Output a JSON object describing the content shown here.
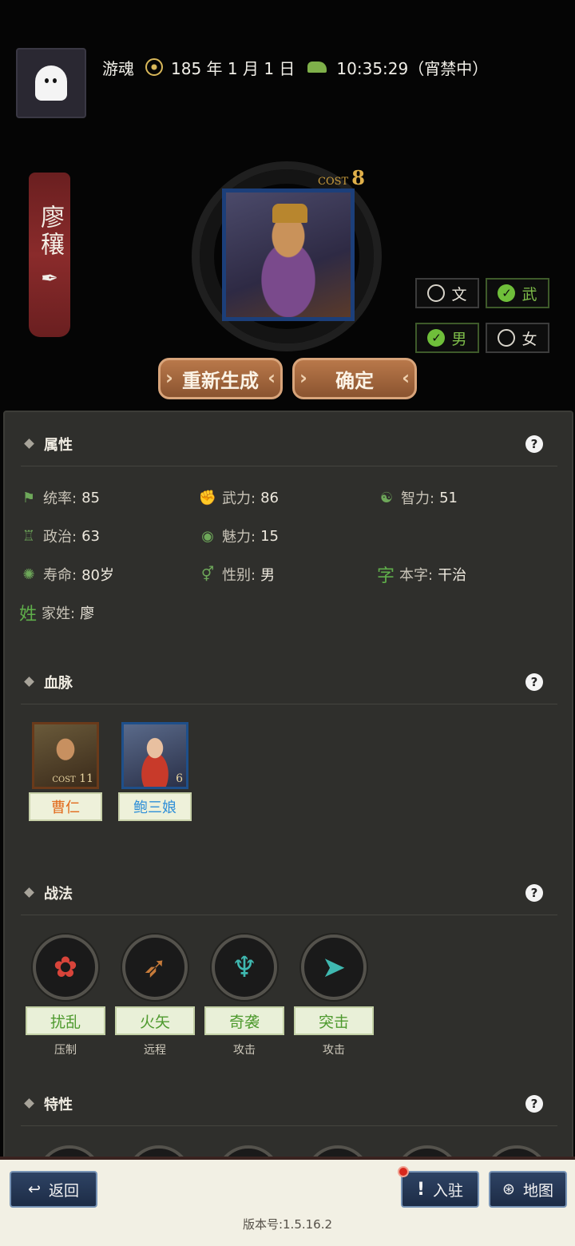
{
  "header": {
    "player_name": "游魂",
    "date": "185 年 1 月 1 日",
    "time": "10:35:29（宵禁中）"
  },
  "general": {
    "name": "廖穰",
    "cost_label": "COST",
    "cost_value": "8"
  },
  "toggles": {
    "wen": "文",
    "wu": "武",
    "male": "男",
    "female": "女"
  },
  "actions": {
    "regenerate": "重新生成",
    "confirm": "确定"
  },
  "attributes": {
    "title": "属性",
    "help": "?",
    "tongshuai_label": "统率:",
    "tongshuai": "85",
    "wuli_label": "武力:",
    "wuli": "86",
    "zhili_label": "智力:",
    "zhili": "51",
    "zhengzhi_label": "政治:",
    "zhengzhi": "63",
    "meili_label": "魅力:",
    "meili": "15",
    "shouming_label": "寿命:",
    "shouming": "80岁",
    "xingbie_label": "性别:",
    "xingbie": "男",
    "benzi_icon": "字",
    "benzi_label": "本字:",
    "benzi": "干治",
    "jiaxing_icon": "姓",
    "jiaxing_label": "家姓:",
    "jiaxing": "廖"
  },
  "bloodline": {
    "title": "血脉",
    "help": "?",
    "items": [
      {
        "name": "曹仁",
        "cost_label": "COST",
        "cost": "11",
        "name_color": "#e26a1c"
      },
      {
        "name": "鲍三娘",
        "cost": "6",
        "name_color": "#2f8fd8"
      }
    ]
  },
  "tactics": {
    "title": "战法",
    "help": "?",
    "items": [
      {
        "name": "扰乱",
        "type": "压制",
        "icon": "flower-icon",
        "icon_color": "#d8443a"
      },
      {
        "name": "火矢",
        "type": "远程",
        "icon": "arrow-icon",
        "icon_color": "#c77b3a"
      },
      {
        "name": "奇袭",
        "type": "攻击",
        "icon": "claw-icon",
        "icon_color": "#3fb8b0"
      },
      {
        "name": "突击",
        "type": "攻击",
        "icon": "rush-icon",
        "icon_color": "#3fb8b0"
      }
    ]
  },
  "traits": {
    "title": "特性",
    "help": "?"
  },
  "bottom_bar": {
    "back": "返回",
    "station": "入驻",
    "map": "地图",
    "version": "版本号:1.5.16.2"
  }
}
